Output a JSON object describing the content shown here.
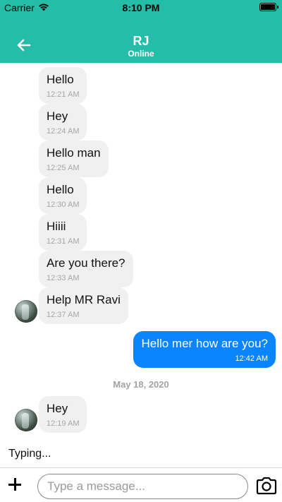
{
  "status_bar": {
    "carrier": "Carrier",
    "time": "8:10 PM"
  },
  "header": {
    "title": "RJ",
    "subtitle": "Online",
    "background": "#25bca8"
  },
  "messages": [
    {
      "text": "Hello",
      "time": "12:21 AM",
      "direction": "incoming"
    },
    {
      "text": "Hey",
      "time": "12:24 AM",
      "direction": "incoming"
    },
    {
      "text": "Hello man",
      "time": "12:25 AM",
      "direction": "incoming"
    },
    {
      "text": "Hello",
      "time": "12:30 AM",
      "direction": "incoming"
    },
    {
      "text": "Hiiii",
      "time": "12:31 AM",
      "direction": "incoming"
    },
    {
      "text": "Are you there?",
      "time": "12:33 AM",
      "direction": "incoming"
    },
    {
      "text": "Help MR Ravi",
      "time": "12:37 AM",
      "direction": "incoming"
    },
    {
      "text": "Hello mer how are you?",
      "time": "12:42 AM",
      "direction": "outgoing"
    },
    {
      "text": "Hey",
      "time": "12:19 AM",
      "direction": "incoming"
    }
  ],
  "date_separator": "May 18, 2020",
  "typing_indicator": "Typing...",
  "composer": {
    "placeholder": "Type a message..."
  },
  "colors": {
    "outgoing_bubble": "#0a84ff",
    "incoming_bubble": "#f0f0f0"
  }
}
